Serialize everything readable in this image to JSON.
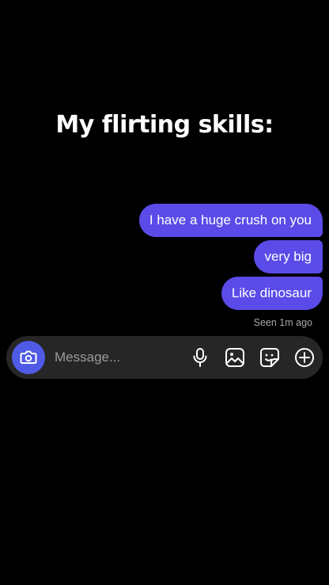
{
  "caption": "My flirting skills:",
  "messages": [
    {
      "text": "I have a huge crush on you"
    },
    {
      "text": "very big"
    },
    {
      "text": "Like dinosaur"
    }
  ],
  "status": "Seen 1m ago",
  "composer": {
    "placeholder": "Message...",
    "icons": [
      "camera-icon",
      "microphone-icon",
      "gallery-icon",
      "sticker-icon",
      "plus-icon"
    ]
  },
  "colors": {
    "background": "#000000",
    "bubble": "#5b4be8",
    "composer": "#262626",
    "camera_button": "#4f5be6",
    "muted_text": "#a8a8a8"
  }
}
